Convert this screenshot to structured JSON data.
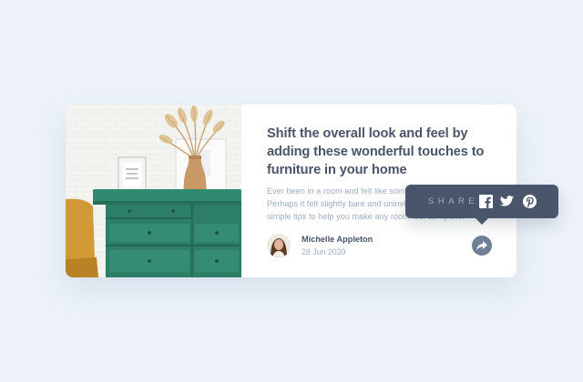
{
  "article": {
    "title": "Shift the overall look and feel by adding these wonderful touches to furniture in your home",
    "description": "Ever been in a room and felt like something was missing?\nPerhaps it felt slightly bare and uninviting. I've got some\nsimple tips to help you make any room feel complete.",
    "image_alt": "drawers"
  },
  "author": {
    "name": "Michelle Appleton",
    "date": "28 Jun 2020"
  },
  "share": {
    "label": "SHARE",
    "networks": [
      "facebook-icon",
      "twitter-icon",
      "pinterest-icon"
    ]
  },
  "colors": {
    "background": "#ecf2f8",
    "card": "#ffffff",
    "heading": "#48556a",
    "text": "#9eafc2",
    "share_button": "#6e8098",
    "popup": "#48556a"
  }
}
